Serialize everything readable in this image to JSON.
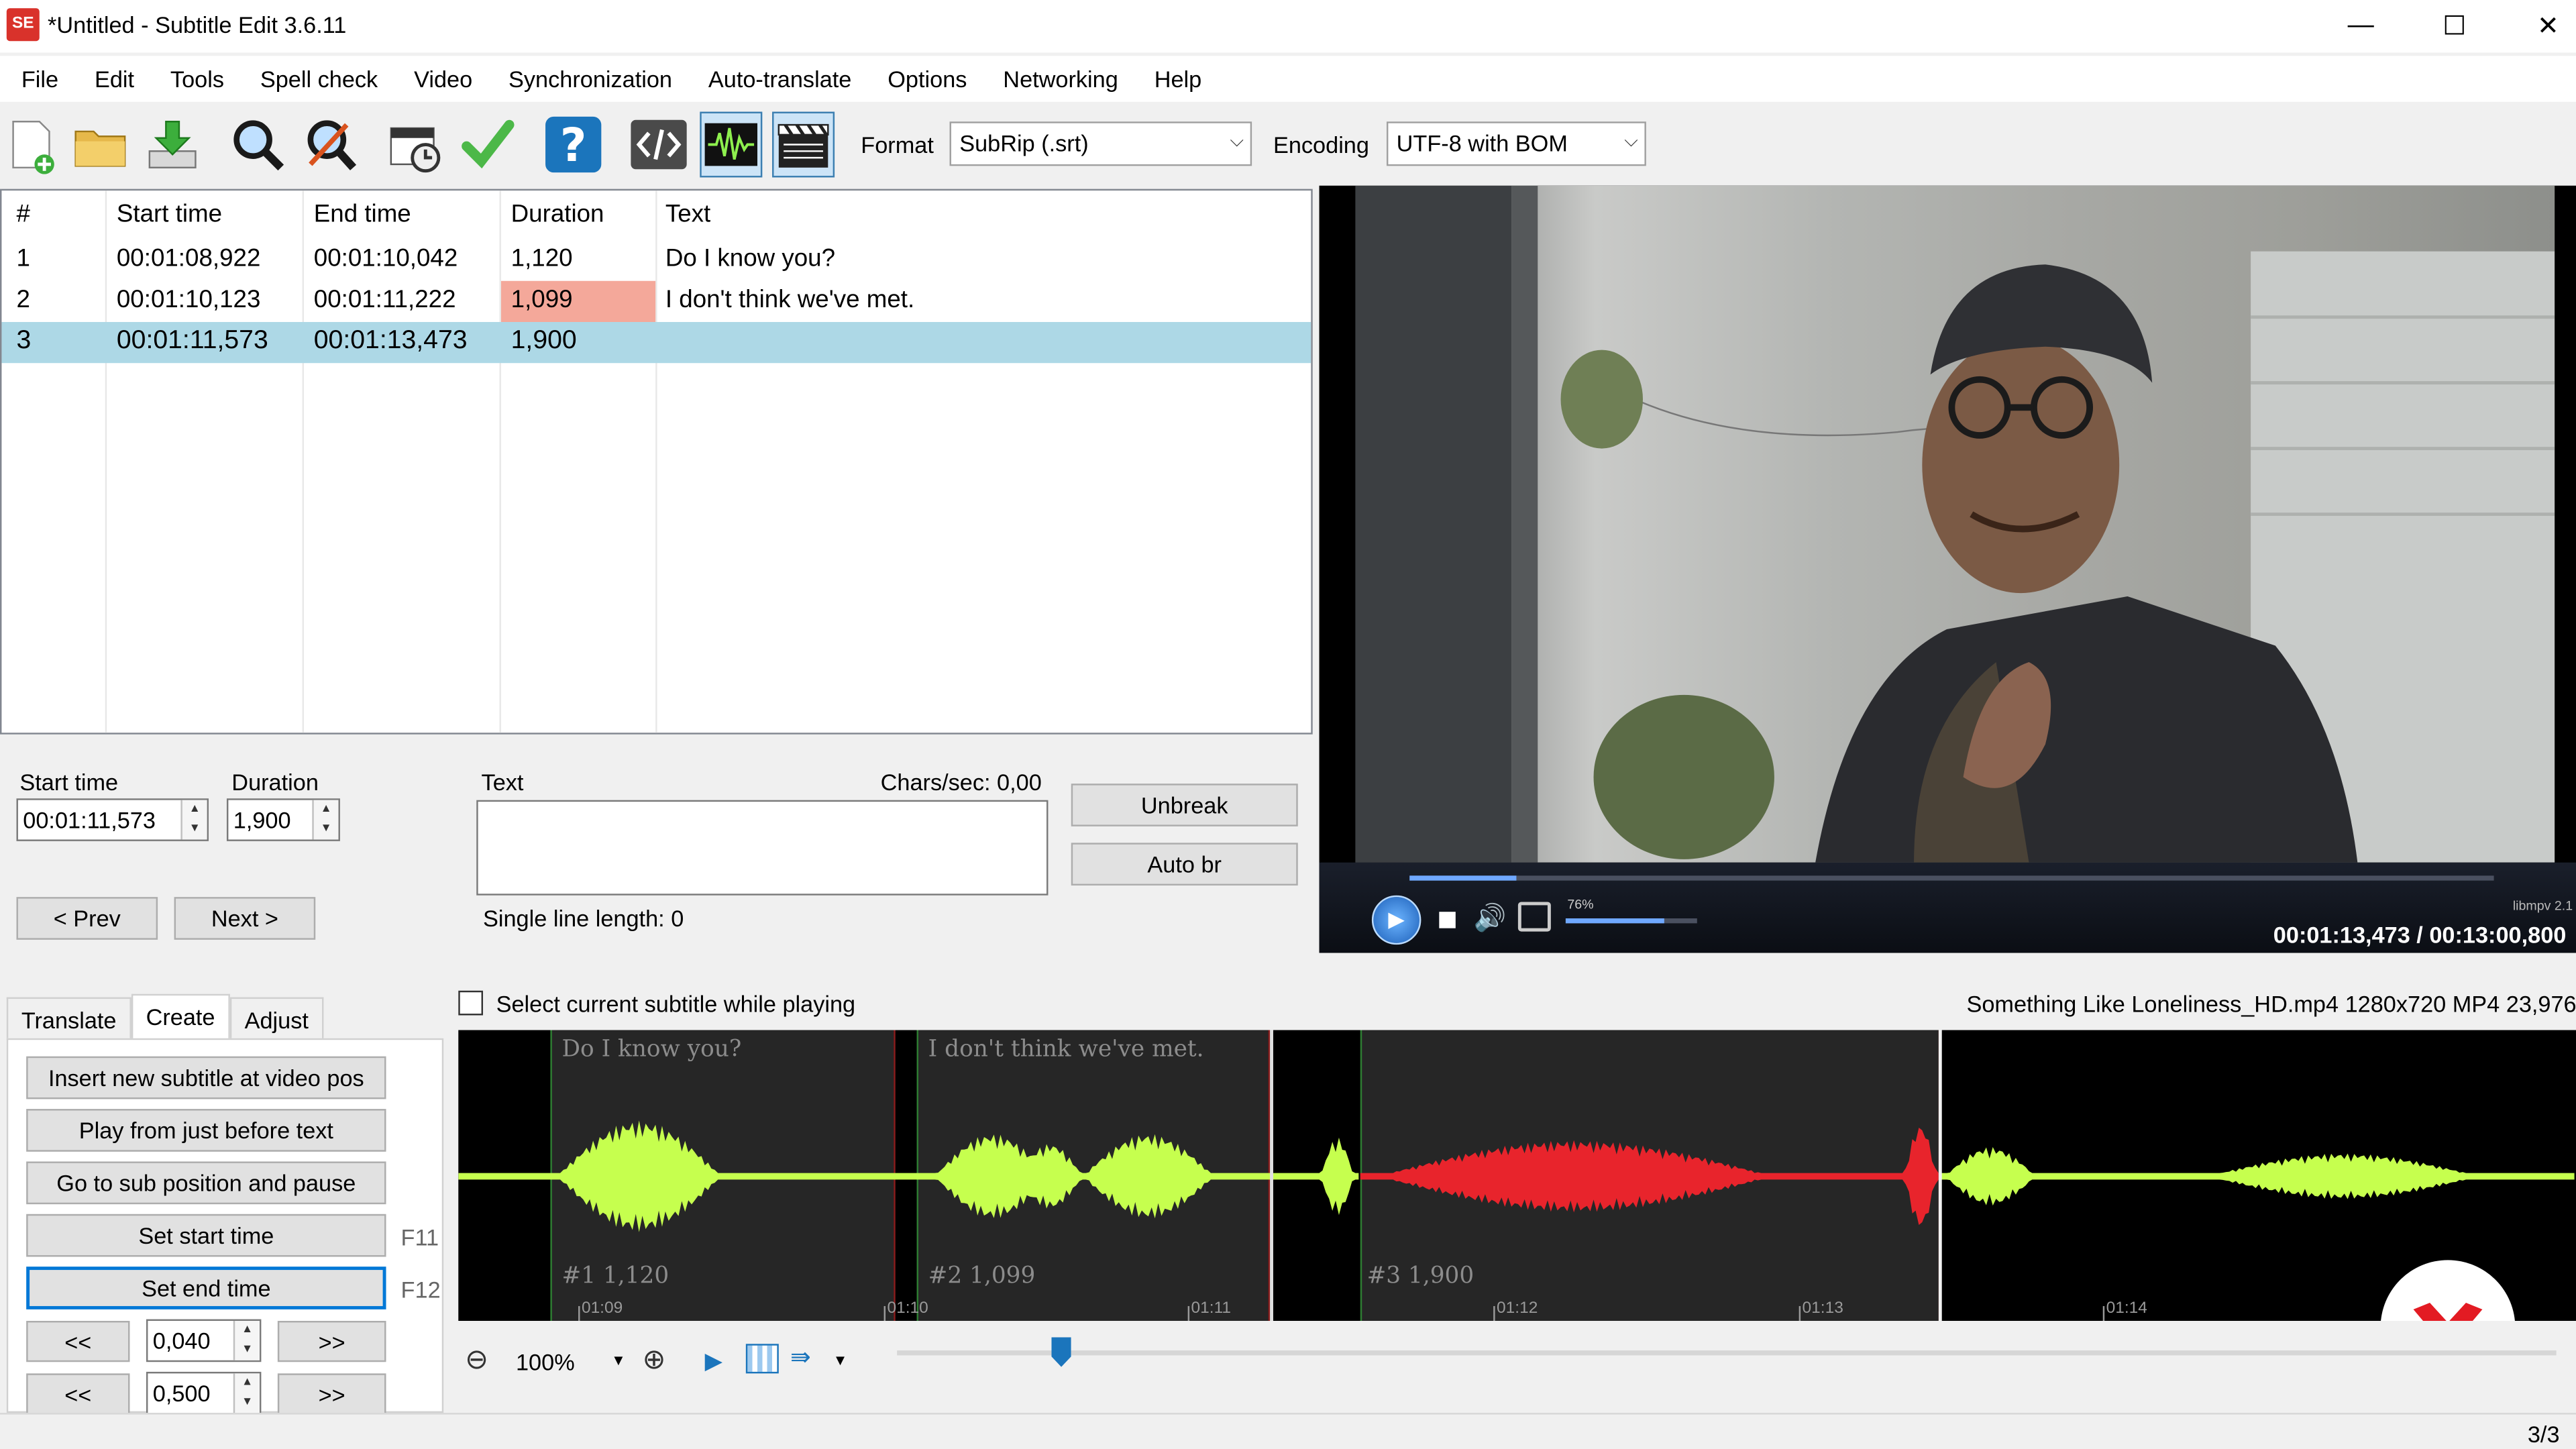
{
  "window": {
    "app_icon": "SE",
    "title": "*Untitled - Subtitle Edit 3.6.11"
  },
  "menu": [
    "File",
    "Edit",
    "Tools",
    "Spell check",
    "Video",
    "Synchronization",
    "Auto-translate",
    "Options",
    "Networking",
    "Help"
  ],
  "toolbar": {
    "icons": [
      "new-file-icon",
      "open-folder-icon",
      "download-icon",
      "find-icon",
      "replace-icon",
      "visual-sync-icon",
      "check-icon",
      "help-icon",
      "source-view-icon",
      "waveform-icon",
      "video-clapper-icon"
    ],
    "format_label": "Format",
    "format_value": "SubRip (.srt)",
    "encoding_label": "Encoding",
    "encoding_value": "UTF-8 with BOM"
  },
  "grid": {
    "headers": [
      "#",
      "Start time",
      "End time",
      "Duration",
      "Text"
    ],
    "rows": [
      {
        "num": "1",
        "start": "00:01:08,922",
        "end": "00:01:10,042",
        "duration": "1,120",
        "text": "Do I know you?"
      },
      {
        "num": "2",
        "start": "00:01:10,123",
        "end": "00:01:11,222",
        "duration": "1,099",
        "text": "I don't think we've met."
      },
      {
        "num": "3",
        "start": "00:01:11,573",
        "end": "00:01:13,473",
        "duration": "1,900",
        "text": ""
      }
    ],
    "selected_row": 3,
    "warning_color": "#f4a89a",
    "selection_color": "#add8e6"
  },
  "edit": {
    "start_time_label": "Start time",
    "start_time_value": "00:01:11,573",
    "duration_label": "Duration",
    "duration_value": "1,900",
    "text_label": "Text",
    "chars_sec": "Chars/sec: 0,00",
    "unbreak": "Unbreak",
    "auto_br": "Auto br",
    "prev": "< Prev",
    "next": "Next >",
    "single_line": "Single line length: 0"
  },
  "video": {
    "volume": "76%",
    "player": "libmpv 2.1",
    "timecode": "00:01:13,473 / 00:13:00,800"
  },
  "tabs": {
    "items": [
      "Translate",
      "Create",
      "Adjust"
    ],
    "active": "Create"
  },
  "create": {
    "insert": "Insert new subtitle at video pos",
    "play_before": "Play from just before text",
    "goto_pause": "Go to sub position and pause",
    "set_start": "Set start time",
    "set_start_key": "F11",
    "set_end": "Set end time",
    "set_end_key": "F12",
    "back": "<<",
    "forward": ">>",
    "step1": "0,040",
    "step2": "0,500"
  },
  "waveform": {
    "checkbox_label": "Select current subtitle while playing",
    "file_info": "Something Like Loneliness_HD.mp4 1280x720 MP4 23,976",
    "subs": [
      {
        "text": "Do I know you?",
        "label": "#1  1,120"
      },
      {
        "text": "I don't think we've met.",
        "label": "#2  1,099"
      },
      {
        "text": "",
        "label": "#3  1,900"
      }
    ],
    "ticks": [
      "01:09",
      "01:10",
      "01:11",
      "01:12",
      "01:13",
      "01:14"
    ],
    "zoom": "100%",
    "wave_color": "#c6ff4e",
    "selected_color": "#e8242c"
  },
  "status": {
    "position": "3/3"
  }
}
